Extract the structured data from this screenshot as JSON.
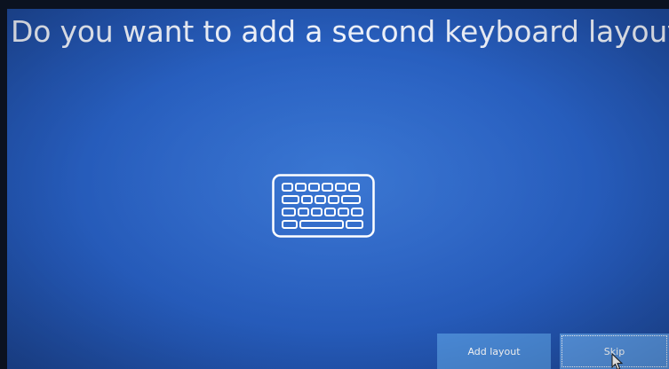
{
  "page": {
    "title": "Do you want to add a second keyboard layout?"
  },
  "icons": {
    "main": "keyboard-icon",
    "pointer": "mouse-cursor-icon"
  },
  "actions": {
    "add_layout_label": "Add layout",
    "skip_label": "Skip"
  },
  "colors": {
    "background": "#2a63c4",
    "button_add": "#4a8ad8",
    "button_skip": "#5593e0",
    "text": "#ffffff"
  }
}
